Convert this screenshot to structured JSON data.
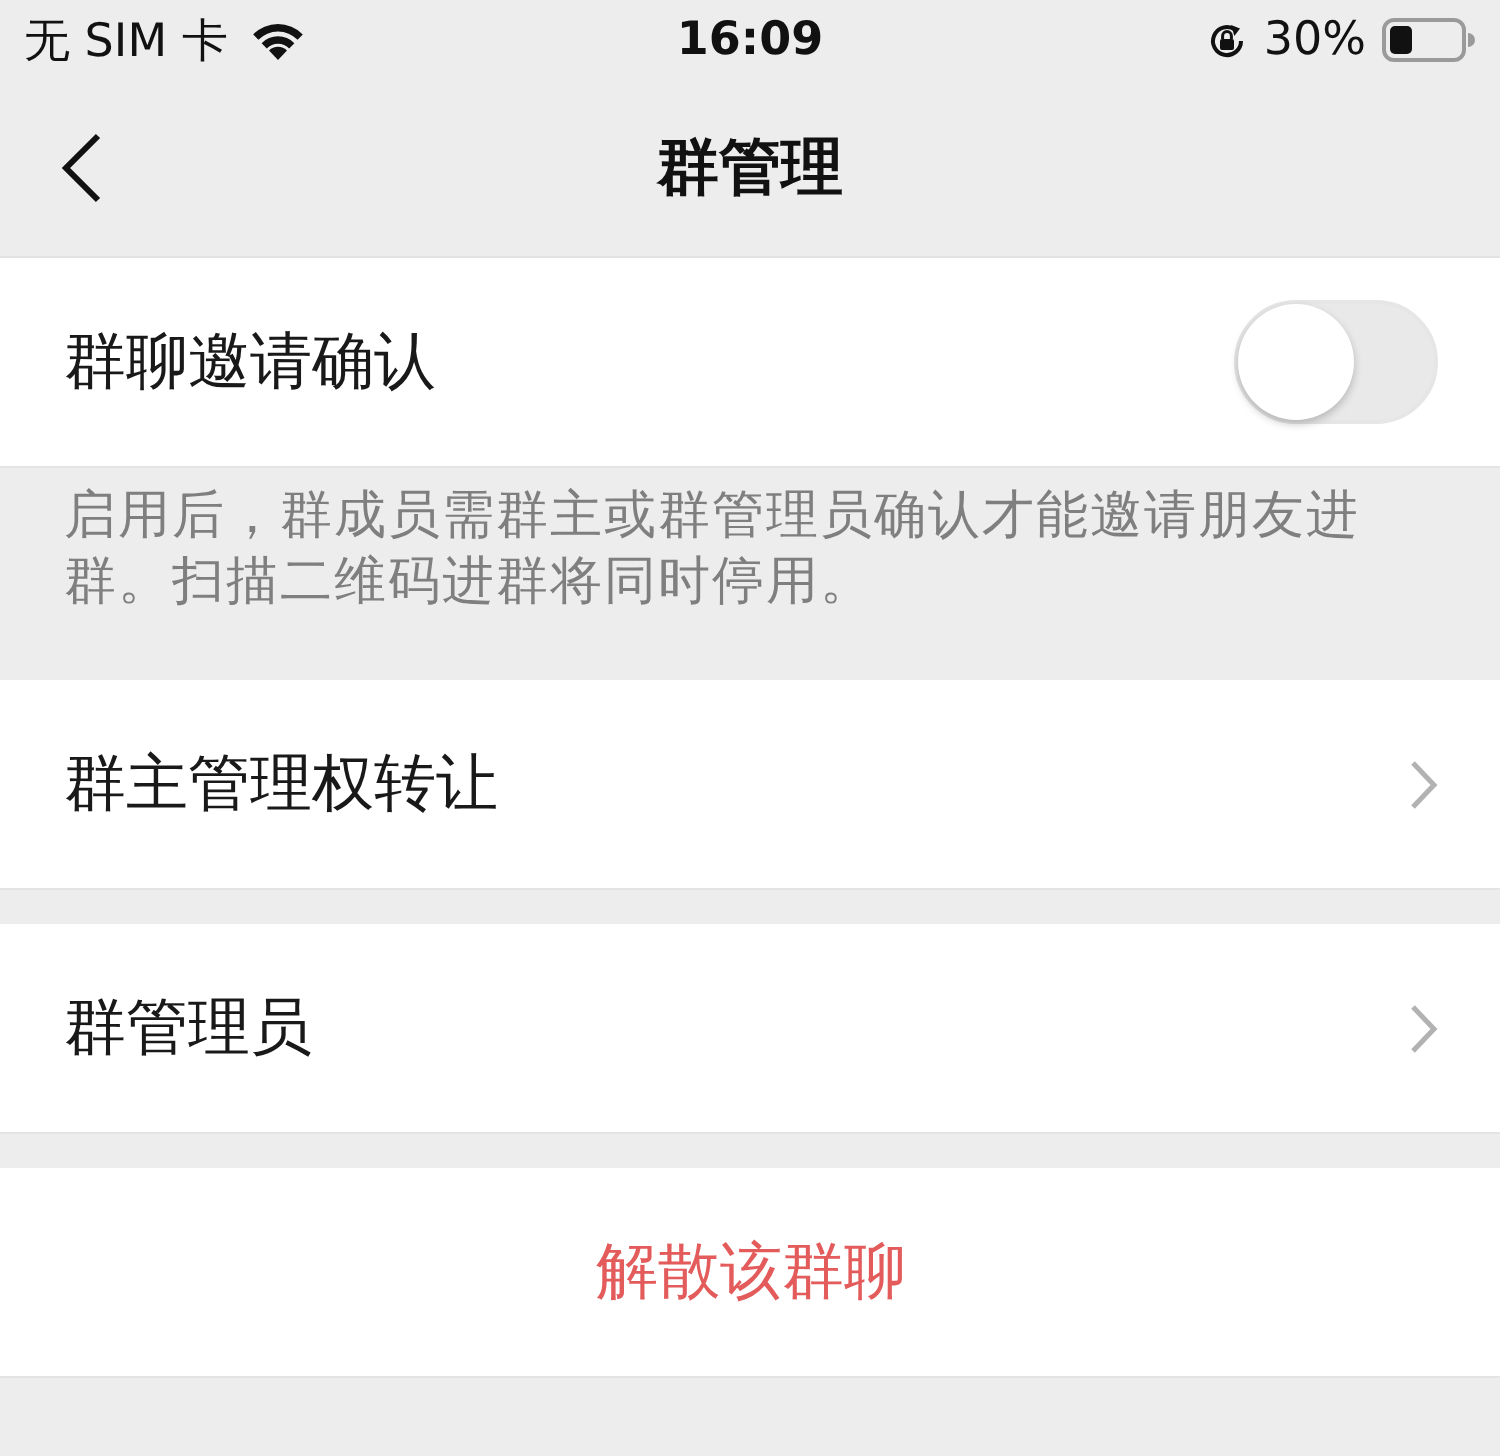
{
  "status_bar": {
    "carrier": "无 SIM 卡",
    "time": "16:09",
    "battery_percent": "30%"
  },
  "nav_bar": {
    "title": "群管理"
  },
  "sections": [
    {
      "kind": "toggle",
      "label": "群聊邀请确认",
      "on": false,
      "footer": "启用后，群成员需群主或群管理员确认才能邀请朋友进群。扫描二维码进群将同时停用。"
    },
    {
      "kind": "link",
      "label": "群主管理权转让"
    },
    {
      "kind": "link",
      "label": "群管理员"
    },
    {
      "kind": "danger",
      "label": "解散该群聊"
    }
  ]
}
